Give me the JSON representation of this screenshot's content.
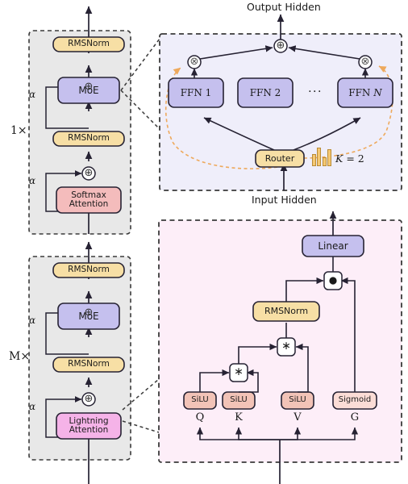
{
  "figure": {
    "type": "architecture-diagram",
    "title_top": "Output Hidden",
    "title_bottom": "Input Hidden"
  },
  "left_column": {
    "block_top": {
      "repeat_label": "1×",
      "nodes": [
        {
          "name": "rmsnorm-top",
          "label": "RMSNorm",
          "color": "#f7dfa5"
        },
        {
          "name": "residual-add-top",
          "label": "⊕"
        },
        {
          "name": "moe",
          "label": "MoE",
          "color": "#c5c0ee"
        },
        {
          "name": "alpha-top",
          "label": "α"
        },
        {
          "name": "rmsnorm-mid",
          "label": "RMSNorm",
          "color": "#f7dfa5"
        },
        {
          "name": "residual-add-bottom",
          "label": "⊕"
        },
        {
          "name": "softmax-attention",
          "label": "Softmax\nAttention",
          "line1": "Softmax",
          "line2": "Attention",
          "color": "#f4bcbc"
        },
        {
          "name": "alpha-bottom",
          "label": "α"
        }
      ]
    },
    "block_bottom": {
      "repeat_label": "M×",
      "nodes": [
        {
          "name": "rmsnorm-top",
          "label": "RMSNorm",
          "color": "#f7dfa5"
        },
        {
          "name": "residual-add-top",
          "label": "⊕"
        },
        {
          "name": "moe",
          "label": "MoE",
          "color": "#c5c0ee"
        },
        {
          "name": "alpha-top",
          "label": "α"
        },
        {
          "name": "rmsnorm-mid",
          "label": "RMSNorm",
          "color": "#f7dfa5"
        },
        {
          "name": "residual-add-bottom",
          "label": "⊕"
        },
        {
          "name": "lightning-attention",
          "label": "Lightning\nAttention",
          "line1": "Lightning",
          "line2": "Attention",
          "color": "#f5b3e8"
        },
        {
          "name": "alpha-bottom",
          "label": "α"
        }
      ]
    }
  },
  "moe_panel": {
    "name": "moe-detail-panel",
    "bg": "#efeefa",
    "input_label": "Input Hidden",
    "output_label": "Output Hidden",
    "experts": [
      {
        "name": "ffn-1",
        "label": "FFN 1",
        "prefix": "FFN",
        "index": "1"
      },
      {
        "name": "ffn-2",
        "label": "FFN 2",
        "prefix": "FFN",
        "index": "2"
      },
      {
        "name": "ffn-ellipsis",
        "label": "···"
      },
      {
        "name": "ffn-n",
        "label": "FFN N",
        "prefix": "FFN",
        "index": "N"
      }
    ],
    "router": {
      "name": "router",
      "label": "Router",
      "color": "#f7dfa5"
    },
    "topk": {
      "label": "K = 2",
      "k_symbol": "K",
      "equals": "=",
      "value": "2"
    },
    "histogram": {
      "name": "router-histogram-icon",
      "bars": [
        0.62,
        1.0,
        0.42,
        0.9
      ],
      "color": "#f5c873"
    },
    "ops": [
      {
        "name": "gate-multiply-left",
        "label": "⊗"
      },
      {
        "name": "gate-multiply-right",
        "label": "⊗"
      },
      {
        "name": "expert-sum-add",
        "label": "⊕"
      }
    ],
    "routing_path_color": "#eea95c"
  },
  "attention_panel": {
    "name": "lightning-attention-detail-panel",
    "bg": "#fdeef8",
    "inputs": [
      {
        "name": "input-q",
        "label": "Q",
        "activation": "SiLU"
      },
      {
        "name": "input-k",
        "label": "K",
        "activation": "SiLU"
      },
      {
        "name": "input-v",
        "label": "V",
        "activation": "SiLU"
      },
      {
        "name": "input-g",
        "label": "G",
        "activation": "Sigmoid"
      }
    ],
    "activation_boxes": [
      {
        "name": "silu-q",
        "label": "SiLU",
        "color": "#f2c3b7"
      },
      {
        "name": "silu-k",
        "label": "SiLU",
        "color": "#f2c3b7"
      },
      {
        "name": "silu-v",
        "label": "SiLU",
        "color": "#f2c3b7"
      },
      {
        "name": "sigmoid-g",
        "label": "Sigmoid",
        "color": "#fbdcd6"
      }
    ],
    "ops": [
      {
        "name": "matmul-qk",
        "label": "∗"
      },
      {
        "name": "matmul-qkv",
        "label": "∗"
      },
      {
        "name": "hadamard-gate",
        "label": "●"
      }
    ],
    "rmsnorm": {
      "name": "rmsnorm-attention",
      "label": "RMSNorm",
      "color": "#f7dfa5"
    },
    "linear": {
      "name": "linear-output",
      "label": "Linear",
      "color": "#c5c0ee"
    }
  },
  "colors": {
    "stroke": "#262233",
    "dashed_border": "#3a3a3a",
    "block_bg": "#e8e8e8",
    "moe_purple": "#c5c0ee",
    "rmsnorm_tan": "#f7dfa5",
    "softmax_red": "#f4bcbc",
    "lightning_pink": "#f5b3e8",
    "silu_peach": "#f2c3b7",
    "sigmoid_peach": "#fbdcd6",
    "orange_route": "#eea95c"
  }
}
